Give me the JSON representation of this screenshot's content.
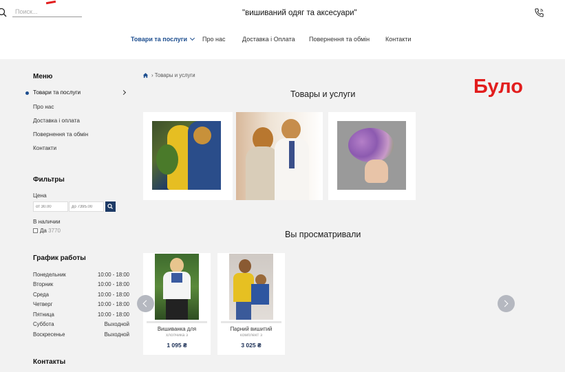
{
  "header": {
    "search_placeholder": "Поиск...",
    "site_title": "\"вишиваний одяг та аксесуари\"",
    "nav": [
      "Товари та послуги",
      "Про нас",
      "Доставка і Оплата",
      "Повернення та обмін",
      "Контакти"
    ],
    "accent_color": "#1d4e8f"
  },
  "sidebar": {
    "menu_title": "Меню",
    "menu": [
      "Товари та послуги",
      "Про нас",
      "Доставка і оплата",
      "Повернення та обмін",
      "Контакти"
    ],
    "filters_title": "Фильтры",
    "price_label": "Цена",
    "price_from_placeholder": "от 30.00",
    "price_to_placeholder": "до 7395.00",
    "stock_label": "В наличии",
    "stock_option": "Да",
    "stock_count": "3770",
    "schedule_title": "График работы",
    "schedule": [
      {
        "day": "Понедельник",
        "time": "10:00 - 18:00"
      },
      {
        "day": "Вторник",
        "time": "10:00 - 18:00"
      },
      {
        "day": "Среда",
        "time": "10:00 - 18:00"
      },
      {
        "day": "Четверг",
        "time": "10:00 - 18:00"
      },
      {
        "day": "Пятница",
        "time": "10:00 - 18:00"
      },
      {
        "day": "Суббота",
        "time": "Выходной"
      },
      {
        "day": "Воскресенье",
        "time": "Выходной"
      }
    ],
    "contacts_title": "Контакты"
  },
  "main": {
    "breadcrumb": "› Товары и услуги",
    "title": "Товары и услуги",
    "overlay_label": "Було",
    "overlay_color": "#e21d1d",
    "viewed_title": "Вы просматривали",
    "products": [
      {
        "name": "Вишиванка для",
        "sub": "хлопчика з",
        "price": "1 095 ₴"
      },
      {
        "name": "Парний вишитий",
        "sub": "комплект з",
        "price": "3 025 ₴"
      }
    ]
  }
}
